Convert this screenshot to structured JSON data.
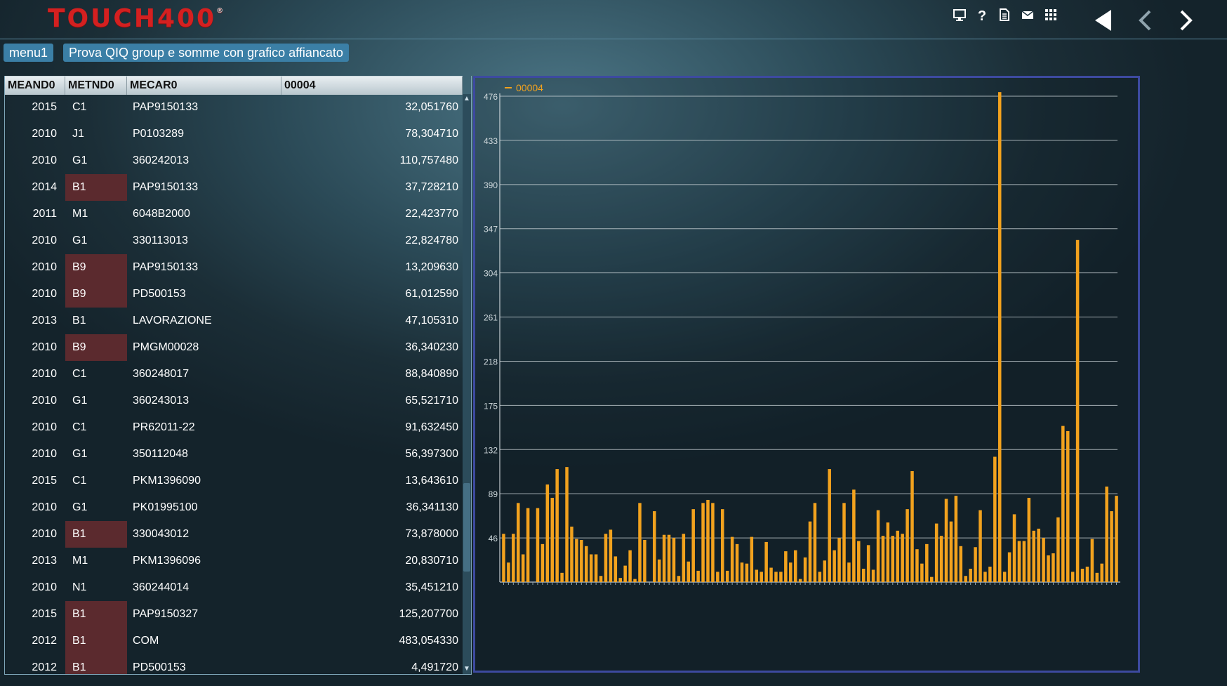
{
  "app": {
    "logo_text": "TOUCH400",
    "logo_mark": "®"
  },
  "toolbar": {
    "icons": [
      "monitor-icon",
      "help-icon",
      "document-icon",
      "mail-icon",
      "grid-icon"
    ],
    "help_glyph": "?",
    "nav": [
      "back-triangle-icon",
      "chevron-left-icon",
      "chevron-right-icon"
    ]
  },
  "tabs": [
    {
      "label": "menu1"
    },
    {
      "label": "Prova QIQ group e somme con grafico affiancato"
    }
  ],
  "grid": {
    "columns": [
      "MEAND0",
      "METND0",
      "MECAR0",
      "00004"
    ],
    "rows": [
      {
        "year": "2015",
        "met": "C1",
        "mec": "PAP9150133",
        "val": "32,051760",
        "highlight": false
      },
      {
        "year": "2010",
        "met": "J1",
        "mec": "P0103289",
        "val": "78,304710",
        "highlight": false
      },
      {
        "year": "2010",
        "met": "G1",
        "mec": "360242013",
        "val": "110,757480",
        "highlight": false
      },
      {
        "year": "2014",
        "met": "B1",
        "mec": "PAP9150133",
        "val": "37,728210",
        "highlight": true
      },
      {
        "year": "2011",
        "met": "M1",
        "mec": "6048B2000",
        "val": "22,423770",
        "highlight": false
      },
      {
        "year": "2010",
        "met": "G1",
        "mec": "330113013",
        "val": "22,824780",
        "highlight": false
      },
      {
        "year": "2010",
        "met": "B9",
        "mec": "PAP9150133",
        "val": "13,209630",
        "highlight": true
      },
      {
        "year": "2010",
        "met": "B9",
        "mec": "PD500153",
        "val": "61,012590",
        "highlight": true
      },
      {
        "year": "2013",
        "met": "B1",
        "mec": "LAVORAZIONE",
        "val": "47,105310",
        "highlight": false
      },
      {
        "year": "2010",
        "met": "B9",
        "mec": "PMGM00028",
        "val": "36,340230",
        "highlight": true
      },
      {
        "year": "2010",
        "met": "C1",
        "mec": "360248017",
        "val": "88,840890",
        "highlight": false
      },
      {
        "year": "2010",
        "met": "G1",
        "mec": "360243013",
        "val": "65,521710",
        "highlight": false
      },
      {
        "year": "2010",
        "met": "C1",
        "mec": "PR62011-22",
        "val": "91,632450",
        "highlight": false
      },
      {
        "year": "2010",
        "met": "G1",
        "mec": "350112048",
        "val": "56,397300",
        "highlight": false
      },
      {
        "year": "2015",
        "met": "C1",
        "mec": "PKM1396090",
        "val": "13,643610",
        "highlight": false
      },
      {
        "year": "2010",
        "met": "G1",
        "mec": "PK01995100",
        "val": "36,341130",
        "highlight": false
      },
      {
        "year": "2010",
        "met": "B1",
        "mec": "330043012",
        "val": "73,878000",
        "highlight": true
      },
      {
        "year": "2013",
        "met": "M1",
        "mec": "PKM1396096",
        "val": "20,830710",
        "highlight": false
      },
      {
        "year": "2010",
        "met": "N1",
        "mec": "360244014",
        "val": "35,451210",
        "highlight": false
      },
      {
        "year": "2015",
        "met": "B1",
        "mec": "PAP9150327",
        "val": "125,207700",
        "highlight": true
      },
      {
        "year": "2012",
        "met": "B1",
        "mec": "COM",
        "val": "483,054330",
        "highlight": true
      },
      {
        "year": "2012",
        "met": "B1",
        "mec": "PD500153",
        "val": "4,491720",
        "highlight": true
      }
    ]
  },
  "chart_data": {
    "type": "bar",
    "series": [
      {
        "name": "00004",
        "values": [
          50,
          22,
          50,
          80,
          30,
          75,
          2,
          75,
          40,
          98,
          85,
          113,
          12,
          115,
          57,
          45,
          44,
          38,
          30,
          30,
          9,
          50,
          54,
          28,
          7,
          19,
          34,
          6,
          80,
          44,
          2,
          72,
          25,
          49,
          49,
          46,
          9,
          50,
          23,
          74,
          14,
          80,
          83,
          80,
          13,
          74,
          14,
          47,
          40,
          22,
          21,
          47,
          15,
          13,
          42,
          17,
          13,
          13,
          33,
          22,
          34,
          6,
          27,
          62,
          80,
          13,
          24,
          113,
          34,
          46,
          80,
          22,
          93,
          43,
          16,
          39,
          15,
          73,
          48,
          61,
          48,
          53,
          50,
          74,
          111,
          35,
          21,
          40,
          8,
          60,
          48,
          84,
          62,
          87,
          38,
          9,
          16,
          37,
          73,
          13,
          18,
          125,
          480,
          13,
          32,
          69,
          43,
          43,
          85,
          53,
          55,
          46,
          29,
          31,
          66,
          155,
          150,
          13,
          336,
          16,
          18,
          45,
          12,
          21,
          96,
          72,
          87
        ],
        "color": "#f2a21e"
      }
    ],
    "yticks": [
      "476",
      "433",
      "390",
      "347",
      "304",
      "261",
      "218",
      "175",
      "132",
      "89",
      "46"
    ],
    "ylim": [
      3,
      476
    ],
    "grid": true,
    "legend": "top-left"
  },
  "colors": {
    "accent": "#3b7fa6",
    "highlight_cell": "#5b2a2e",
    "bar": "#f2a21e",
    "logo": "#d42020",
    "chart_border": "#3d4aa0"
  }
}
